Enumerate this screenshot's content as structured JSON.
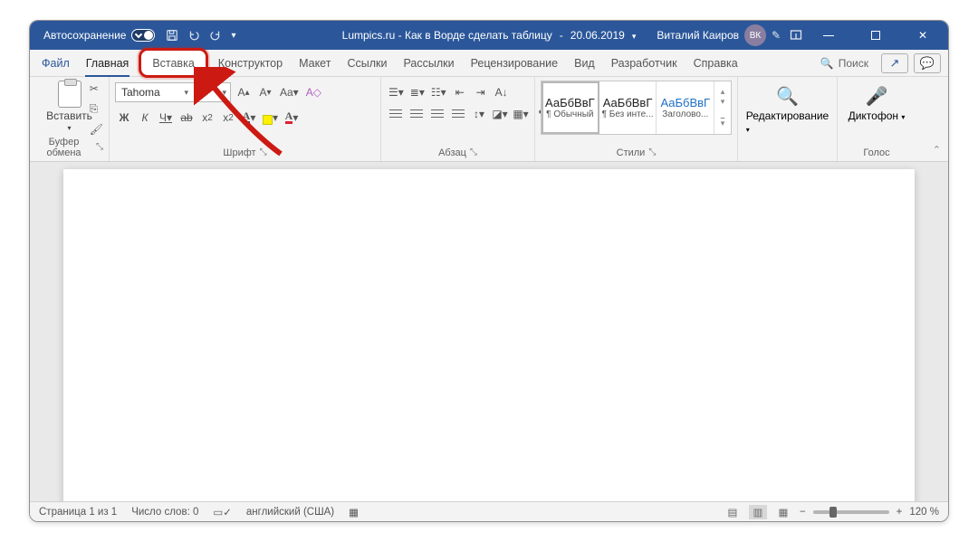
{
  "titlebar": {
    "autosave": "Автосохранение",
    "doc_title": "Lumpics.ru - Как в Ворде сделать таблицу",
    "date": "20.06.2019",
    "user": "Виталий Каиров",
    "avatar": "ВК"
  },
  "tabs": {
    "file": "Файл",
    "items": [
      "Главная",
      "Вставка",
      "Конструктор",
      "Макет",
      "Ссылки",
      "Рассылки",
      "Рецензирование",
      "Вид",
      "Разработчик",
      "Справка"
    ],
    "search": "Поиск"
  },
  "ribbon": {
    "clipboard": {
      "paste": "Вставить",
      "label": "Буфер обмена"
    },
    "font": {
      "name": "Tahoma",
      "bold": "Ж",
      "italic": "К",
      "under": "Ч",
      "label": "Шрифт"
    },
    "paragraph": {
      "label": "Абзац"
    },
    "styles": {
      "label": "Стили",
      "items": [
        {
          "sample": "АаБбВвГ",
          "name": "¶ Обычный"
        },
        {
          "sample": "АаБбВвГ",
          "name": "¶ Без инте..."
        },
        {
          "sample": "АаБбВвГ",
          "name": "Заголово..."
        }
      ]
    },
    "editing": {
      "label": "Редактирование"
    },
    "voice": {
      "btn": "Диктофон",
      "label": "Голос"
    }
  },
  "status": {
    "page": "Страница 1 из 1",
    "words": "Число слов: 0",
    "lang": "английский (США)",
    "zoom": "120 %"
  }
}
